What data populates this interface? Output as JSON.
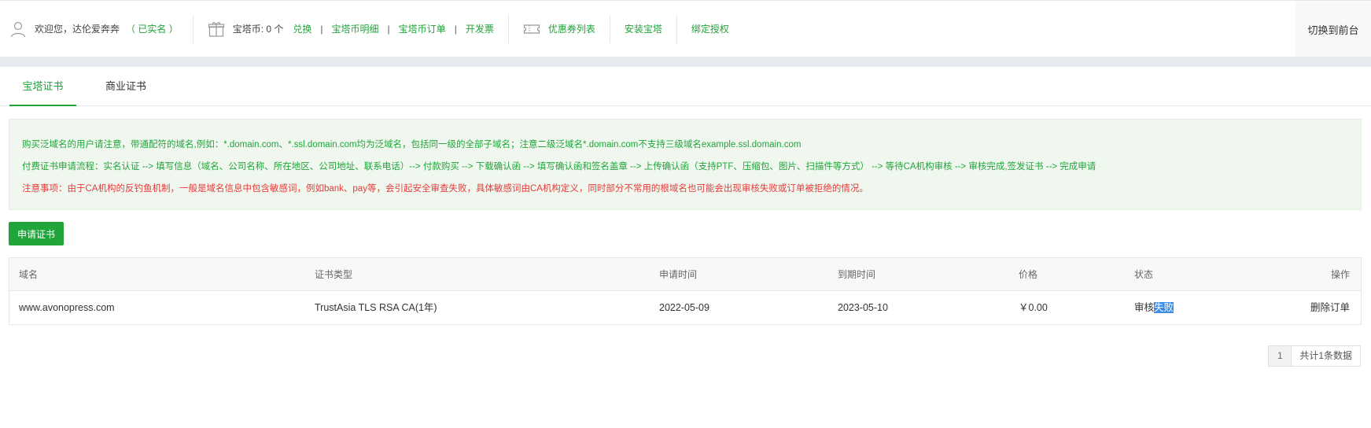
{
  "header": {
    "welcome_prefix": "欢迎您，",
    "username": "达伦爱奔奔",
    "realname_badge": "（ 已实名 ）",
    "coin_label": "宝塔币: 0 个",
    "exchange": "兑换",
    "coin_detail": "宝塔币明细",
    "coin_orders": "宝塔币订单",
    "invoice": "开发票",
    "coupon_list": "优惠券列表",
    "install_bt": "安装宝塔",
    "bind_auth": "绑定授权",
    "separator": "|",
    "switch_front": "切换到前台",
    "icons": [
      "user-icon",
      "gift-icon",
      "ticket-icon"
    ]
  },
  "tabs": [
    {
      "label": "宝塔证书",
      "active": true
    },
    {
      "label": "商业证书",
      "active": false
    }
  ],
  "notice": {
    "line1": "购买泛域名的用户请注意，带通配符的域名,例如：*.domain.com、*.ssl.domain.com均为泛域名，包括同一级的全部子域名；注意二级泛域名*.domain.com不支持三级域名example.ssl.domain.com",
    "line2": "付费证书申请流程：实名认证 --> 填写信息（域名、公司名称、所在地区、公司地址、联系电话）--> 付款购买 --> 下载确认函 --> 填写确认函和签名盖章 --> 上传确认函（支持PTF、压缩包、图片、扫描件等方式） --> 等待CA机构审核 --> 审核完成,签发证书 --> 完成申请",
    "line3": "注意事项：由于CA机构的反钓鱼机制，一般是域名信息中包含敏感词，例如bank、pay等，会引起安全审查失败，具体敏感词由CA机构定义，同时部分不常用的根域名也可能会出现审核失败或订单被拒绝的情况。"
  },
  "apply_button": "申请证书",
  "table": {
    "columns": [
      "域名",
      "证书类型",
      "申请时间",
      "到期时间",
      "价格",
      "状态",
      "操作"
    ],
    "rows": [
      {
        "domain": "www.avonopress.com",
        "type": "TrustAsia TLS RSA CA(1年)",
        "apply_time": "2022-05-09",
        "expire_time": "2023-05-10",
        "price": "￥0.00",
        "status_prefix": "审核",
        "status_selected": "失败",
        "action": "删除订单"
      }
    ]
  },
  "pagination": {
    "page": "1",
    "total": "共计1条数据"
  },
  "colors": {
    "accent": "#20a53a",
    "danger": "#e63b3b",
    "selection": "#3b8be8"
  }
}
